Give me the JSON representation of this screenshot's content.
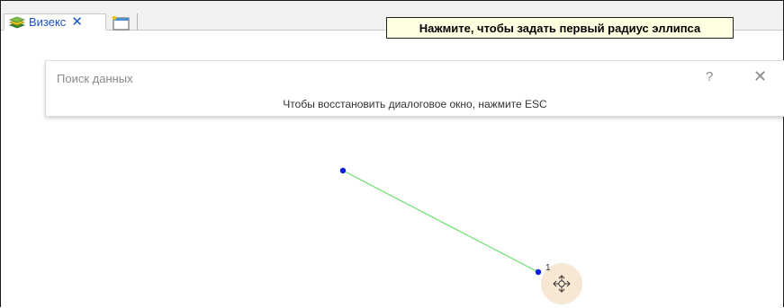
{
  "tabs": [
    {
      "label": "Визекс",
      "icon": "layers-icon",
      "close_glyph": "✕",
      "active": true
    }
  ],
  "new_tab_icon": "new-window-icon",
  "tooltip": {
    "text": "Нажмите, чтобы задать первый радиус эллипса"
  },
  "search_dialog": {
    "title": "Поиск данных",
    "help_glyph": "?",
    "close_glyph": "✕",
    "message": "Чтобы восстановить диалоговое окно, нажмите ESC"
  },
  "drawing": {
    "segment_color": "#66e066",
    "point_color": "#0a1fe0",
    "point_label": "1",
    "cursor_icon": "move-cursor-icon",
    "cursor_bg": "#f7e8d3"
  }
}
